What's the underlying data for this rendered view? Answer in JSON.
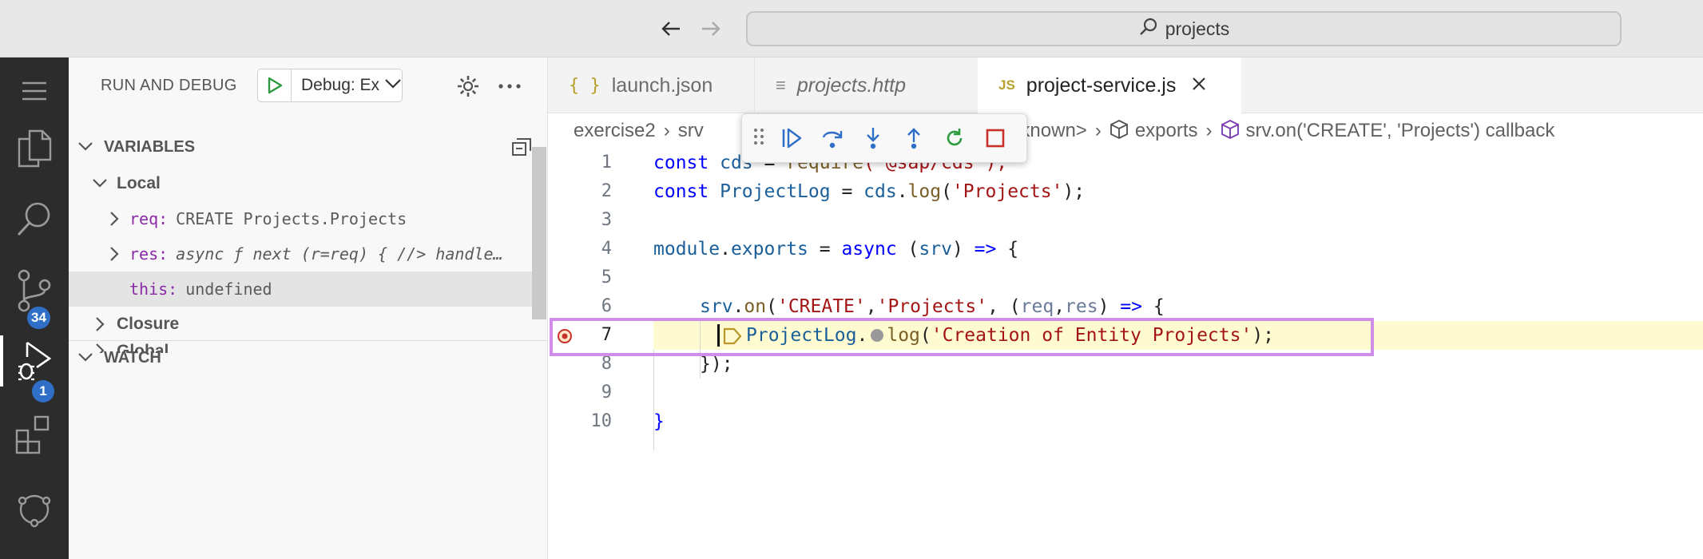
{
  "titlebar": {
    "search_text": "projects"
  },
  "activity_bar": {
    "badges": {
      "source_control": "34",
      "run_debug": "1"
    }
  },
  "sidebar": {
    "title": "RUN AND DEBUG",
    "config": "Debug: Exerc",
    "variables_title": "VARIABLES",
    "local_title": "Local",
    "variables": [
      {
        "name": "req:",
        "value": "CREATE Projects.Projects"
      },
      {
        "name": "res:",
        "value": "async ƒ next (r=req) { //> handle…"
      },
      {
        "name": "this:",
        "value": "undefined"
      }
    ],
    "closure_title": "Closure",
    "global_title": "Global",
    "watch_title": "WATCH"
  },
  "tabs": [
    {
      "label": "launch.json",
      "icon": "{ }"
    },
    {
      "label": "projects.http",
      "icon": "≡"
    },
    {
      "label": "project-service.js",
      "icon": "JS"
    }
  ],
  "breadcrumbs": [
    "exercise2",
    "srv",
    "unknown>",
    "exports",
    "srv.on('CREATE', 'Projects') callback"
  ],
  "editor": {
    "current_line": 7,
    "line_numbers": [
      "1",
      "2",
      "3",
      "4",
      "5",
      "6",
      "7",
      "8",
      "9",
      "10"
    ],
    "lines": {
      "l1": {
        "a": "const",
        "b": "cds",
        "c": " = ",
        "d": "require",
        "e": "('@sap/cds');"
      },
      "l2": {
        "a": "const",
        "b": "ProjectLog",
        "c": " = ",
        "d": "cds",
        "e": ".",
        "f": "log",
        "g": "(",
        "h": "'Projects'",
        "i": ");"
      },
      "l4": {
        "a": "module",
        "b": ".",
        "c": "exports",
        "d": " = ",
        "e": "async",
        "f": " (",
        "g": "srv",
        "h": ") ",
        "i": "=>",
        "j": " {"
      },
      "l6": {
        "a": "srv",
        "b": ".",
        "c": "on",
        "d": "(",
        "e": "'CREATE'",
        "f": ",",
        "g": "'Projects'",
        "h": ", (",
        "i": "req",
        "j": ",",
        "k": "res",
        "l": ") ",
        "m": "=>",
        "n": " {"
      },
      "l7": {
        "a": "ProjectLog",
        "b": ".",
        "c": "log",
        "d": "(",
        "e": "'Creation of Entity Projects'",
        "f": ");"
      },
      "l8": {
        "a": "});"
      },
      "l10": {
        "a": "}"
      }
    }
  }
}
